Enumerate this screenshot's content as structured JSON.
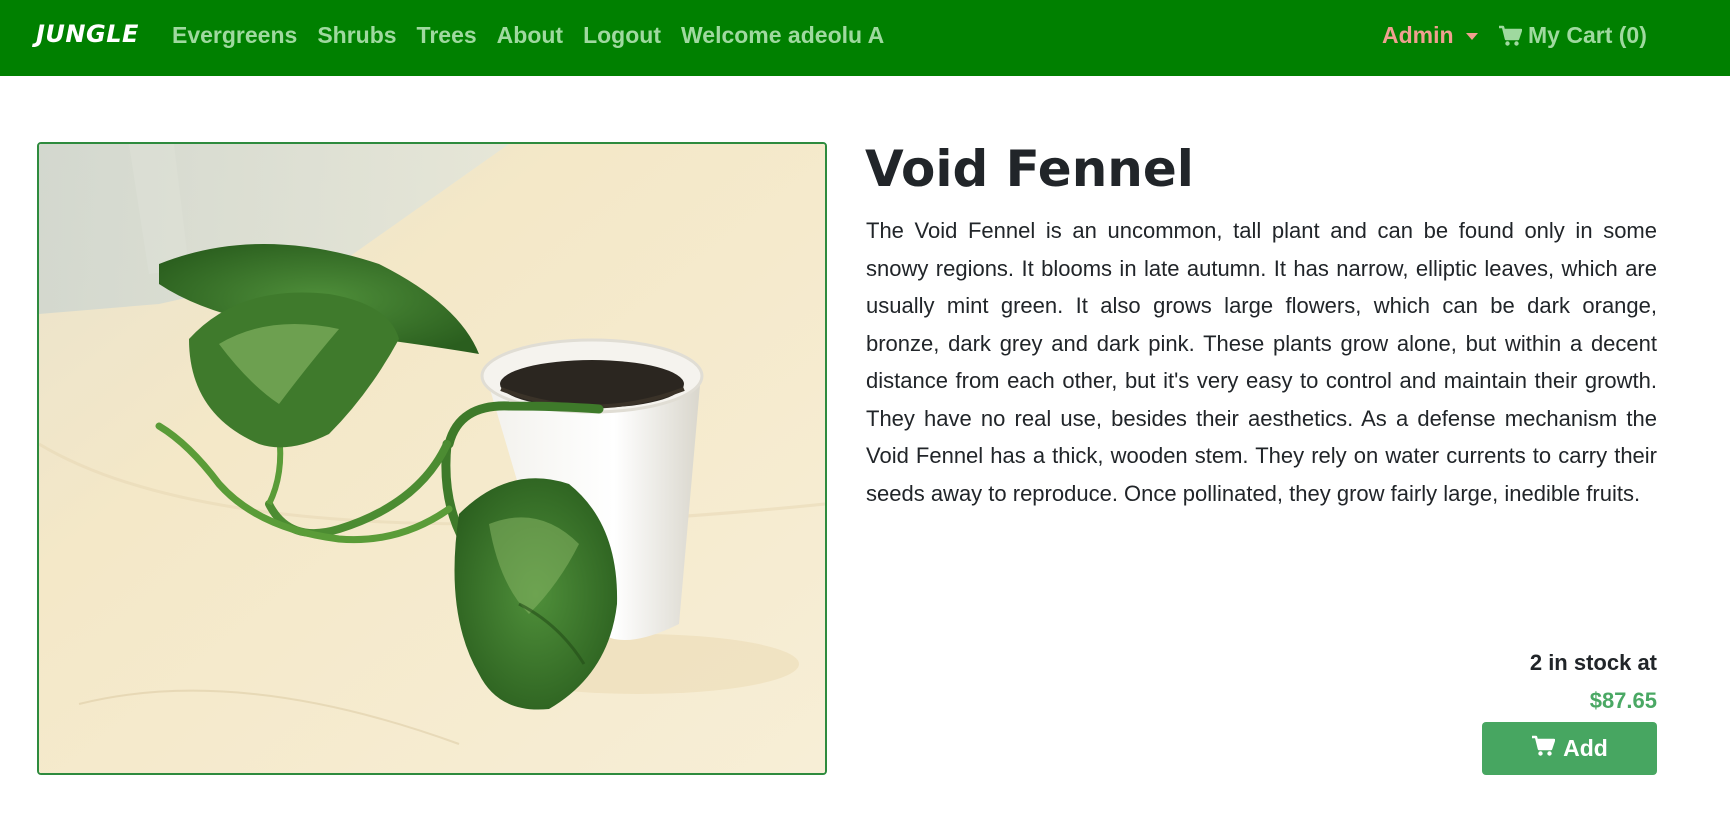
{
  "navbar": {
    "brand": "JUNGLE",
    "links": [
      "Evergreens",
      "Shrubs",
      "Trees",
      "About",
      "Logout",
      "Welcome adeolu A"
    ],
    "admin_label": "Admin",
    "cart_label": "My Cart (0)",
    "background_color": "#008000"
  },
  "product": {
    "title": "Void Fennel",
    "description": "The Void Fennel is an uncommon, tall plant and can be found only in some snowy regions. It blooms in late autumn. It has narrow, elliptic leaves, which are usually mint green. It also grows large flowers, which can be dark orange, bronze, dark grey and dark pink. These plants grow alone, but within a decent distance from each other, but it's very easy to control and maintain their growth. They have no real use, besides their aesthetics. As a defense mechanism the Void Fennel has a thick, wooden stem. They rely on water currents to carry their seeds away to reproduce. Once pollinated, they grow fairly large, inedible fruits.",
    "stock_text": "2 in stock at",
    "price": "$87.65",
    "add_label": "Add",
    "price_color": "#4aa864",
    "button_color": "#47a661"
  },
  "icons": {
    "cart": "shopping-cart-icon",
    "admin_caret": "caret-down-icon"
  }
}
